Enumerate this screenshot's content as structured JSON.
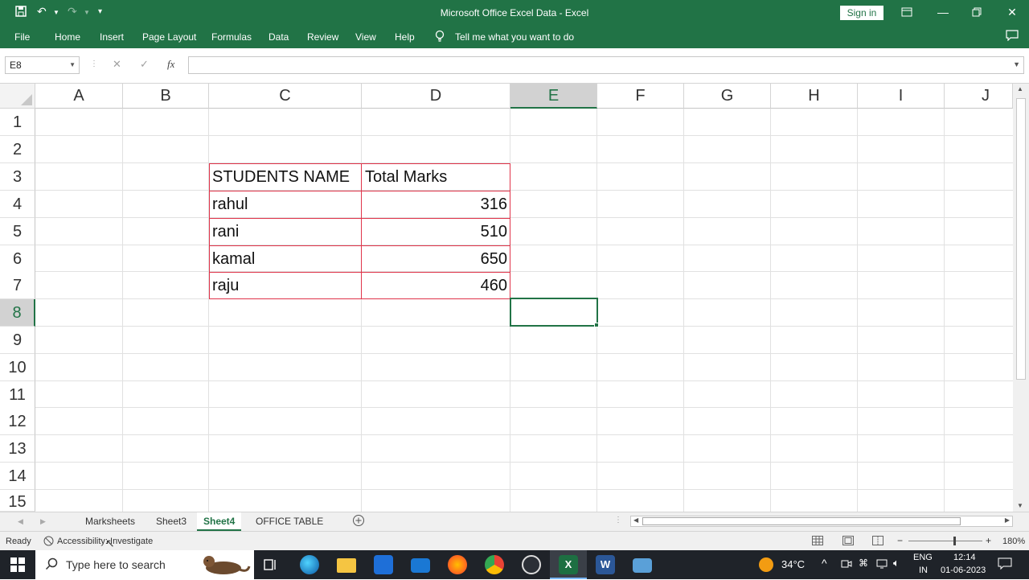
{
  "window": {
    "title": "Microsoft Office Excel Data  -  Excel",
    "sign_in": "Sign in"
  },
  "ribbon": {
    "tabs": [
      "File",
      "Home",
      "Insert",
      "Page Layout",
      "Formulas",
      "Data",
      "Review",
      "View",
      "Help"
    ],
    "tell_me": "Tell me what you want to do"
  },
  "formula_bar": {
    "name_box": "E8",
    "fx_label": "fx",
    "value": ""
  },
  "grid": {
    "columns": [
      "A",
      "B",
      "C",
      "D",
      "E",
      "F",
      "G",
      "H",
      "I",
      "J"
    ],
    "rows": [
      "1",
      "2",
      "3",
      "4",
      "5",
      "6",
      "7",
      "8",
      "9",
      "10",
      "11",
      "12",
      "13",
      "14",
      "15"
    ],
    "selected_column": "E",
    "selected_row": "8"
  },
  "table": {
    "headers": [
      "STUDENTS NAME",
      "Total Marks"
    ],
    "rows": [
      {
        "name": "rahul",
        "marks": "316"
      },
      {
        "name": "rani",
        "marks": "510"
      },
      {
        "name": "kamal",
        "marks": "650"
      },
      {
        "name": "raju",
        "marks": "460"
      }
    ]
  },
  "sheets": {
    "tabs": [
      "Marksheets",
      "Sheet3",
      "Sheet4",
      "OFFICE TABLE"
    ],
    "active": "Sheet4"
  },
  "status": {
    "ready": "Ready",
    "accessibility": "Accessibility: Investigate",
    "zoom": "180%"
  },
  "taskbar": {
    "search_placeholder": "Type here to search",
    "temperature": "34°C",
    "language": "ENG",
    "region": "IN",
    "time": "12:14",
    "date": "01-06-2023"
  },
  "colors": {
    "excel_green": "#217346",
    "table_border": "#e0344a"
  }
}
